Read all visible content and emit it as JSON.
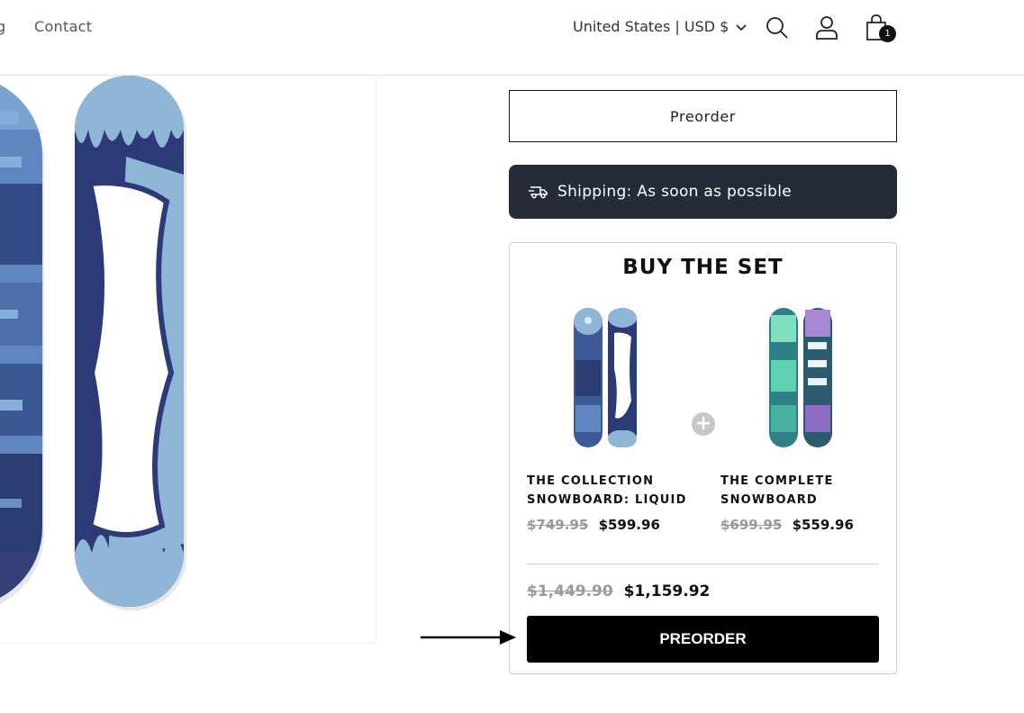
{
  "header": {
    "nav_partial": "g",
    "nav_contact": "Contact",
    "country_selector": "United States | USD $",
    "cart_count": "1",
    "icons": {
      "search": "search-icon",
      "account": "account-icon",
      "cart": "cart-icon",
      "chevron": "chevron-down-icon"
    }
  },
  "product_actions": {
    "preorder_label": "Preorder",
    "shipping_text": "Shipping: As soon as possible",
    "shipping_icon": "truck-icon"
  },
  "bundle": {
    "title": "BUY THE SET",
    "items": [
      {
        "name_line1": "THE COLLECTION",
        "name_line2": "SNOWBOARD: LIQUID",
        "compare_price": "$749.95",
        "price": "$599.96"
      },
      {
        "name_line1": "THE COMPLETE",
        "name_line2": "SNOWBOARD",
        "compare_price": "$699.95",
        "price": "$559.96"
      }
    ],
    "total_compare": "$1,449.90",
    "total_price": "$1,159.92",
    "button_label": "PREORDER"
  },
  "colors": {
    "shipping_bg": "#252b38",
    "button_bg": "#000000",
    "compare_price": "#9a9a9a"
  }
}
